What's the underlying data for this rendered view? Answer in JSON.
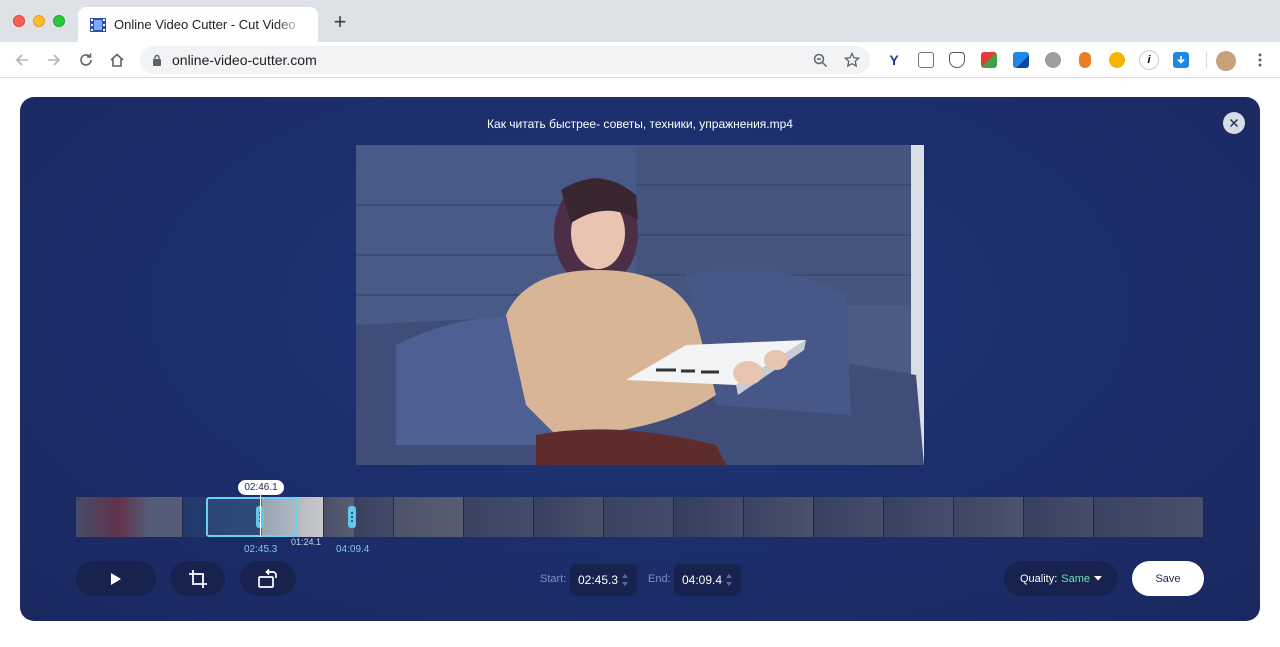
{
  "browser": {
    "tab_title": "Online Video Cutter - Cut Video",
    "new_tab_symbol": "+",
    "url": "online-video-cutter.com",
    "extensions": [
      "v-icon",
      "reader-icon",
      "pocket-icon",
      "color-icon",
      "flag-icon",
      "globe-icon",
      "shield-icon",
      "paw-icon",
      "i-icon",
      "download-icon",
      "profile-avatar"
    ]
  },
  "app": {
    "file_title": "Как читать быстрее- советы, техники, упражнения.mp4",
    "timeline": {
      "playhead_time": "02:46.1",
      "start_label": "02:45.3",
      "duration_label": "01:24.1",
      "end_label": "04:09.4"
    },
    "controls": {
      "start_label": "Start:",
      "start_value": "02:45.3",
      "end_label": "End:",
      "end_value": "04:09.4",
      "quality_label": "Quality:",
      "quality_value": "Same",
      "save_label": "Save"
    },
    "colors": {
      "panel": "#1c2f6d",
      "accent": "#62c8ea",
      "quality_value": "#6ee0b0"
    }
  }
}
